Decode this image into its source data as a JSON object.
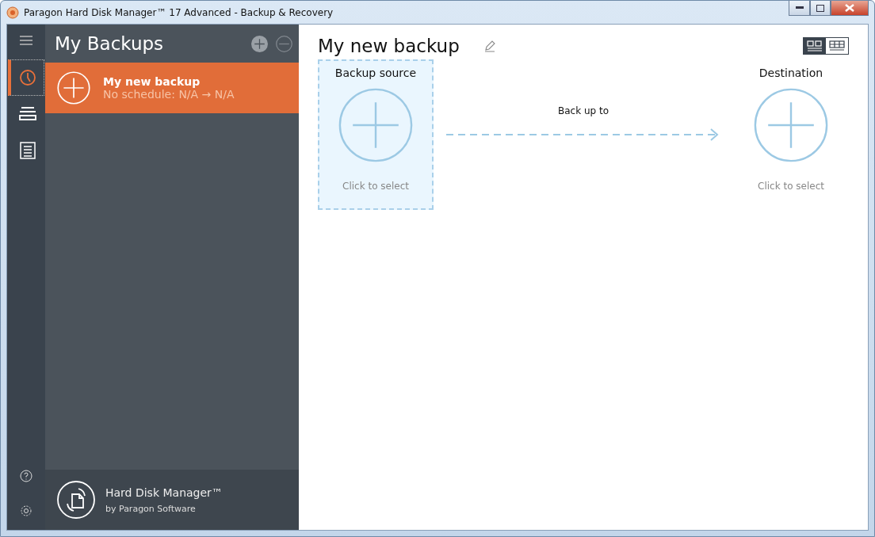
{
  "window": {
    "title": "Paragon Hard Disk Manager™ 17 Advanced - Backup & Recovery"
  },
  "nav": {
    "items": [
      {
        "kind": "history",
        "selected": true
      },
      {
        "kind": "disks",
        "selected": false
      },
      {
        "kind": "list",
        "selected": false
      }
    ]
  },
  "sidebar": {
    "title": "My Backups",
    "backups": [
      {
        "name": "My new backup",
        "schedule": "No schedule: N/A → N/A",
        "selected": true
      }
    ],
    "product": "Hard Disk Manager™",
    "vendor": "by Paragon Software"
  },
  "main": {
    "title": "My new backup",
    "view_modes": [
      {
        "kind": "tiles",
        "selected": true
      },
      {
        "kind": "table",
        "selected": false
      }
    ],
    "source": {
      "label": "Backup source",
      "hint": "Click to select",
      "selected": true
    },
    "link_label": "Back up to",
    "destination": {
      "label": "Destination",
      "hint": "Click to select",
      "selected": false
    }
  }
}
